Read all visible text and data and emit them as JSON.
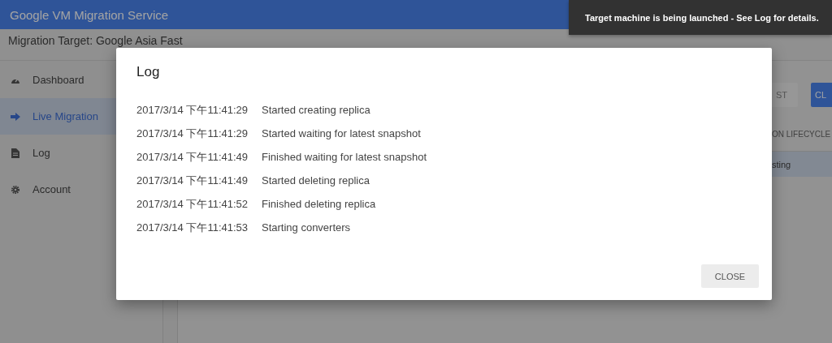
{
  "header": {
    "title": "Google VM Migration Service"
  },
  "toast": {
    "message": "Target machine is being launched - See Log for details."
  },
  "subheader": {
    "title": "Migration Target: Google Asia Fast"
  },
  "sidebar": {
    "items": [
      {
        "label": "Dashboard",
        "kind": "gauge",
        "selected": false
      },
      {
        "label": "Live Migration",
        "kind": "arrow",
        "selected": true
      },
      {
        "label": "Log",
        "kind": "document",
        "selected": false
      },
      {
        "label": "Account",
        "kind": "gear",
        "selected": false
      }
    ]
  },
  "content": {
    "buttons": [
      {
        "label": "ST",
        "kind": "flat"
      },
      {
        "label": "CL",
        "kind": "raised"
      }
    ],
    "table": {
      "column_header": "ON LIFECYCLE",
      "rows": [
        {
          "cell": "sting",
          "selected": true
        }
      ]
    }
  },
  "dialog": {
    "title": "Log",
    "entries": [
      {
        "time": "2017/3/14 下午11:41:29",
        "message": "Started creating replica"
      },
      {
        "time": "2017/3/14 下午11:41:29",
        "message": "Started waiting for latest snapshot"
      },
      {
        "time": "2017/3/14 下午11:41:49",
        "message": "Finished waiting for latest snapshot"
      },
      {
        "time": "2017/3/14 下午11:41:49",
        "message": "Started deleting replica"
      },
      {
        "time": "2017/3/14 下午11:41:52",
        "message": "Finished deleting replica"
      },
      {
        "time": "2017/3/14 下午11:41:53",
        "message": "Starting converters"
      }
    ],
    "buttons": [
      "CLOSE"
    ]
  }
}
